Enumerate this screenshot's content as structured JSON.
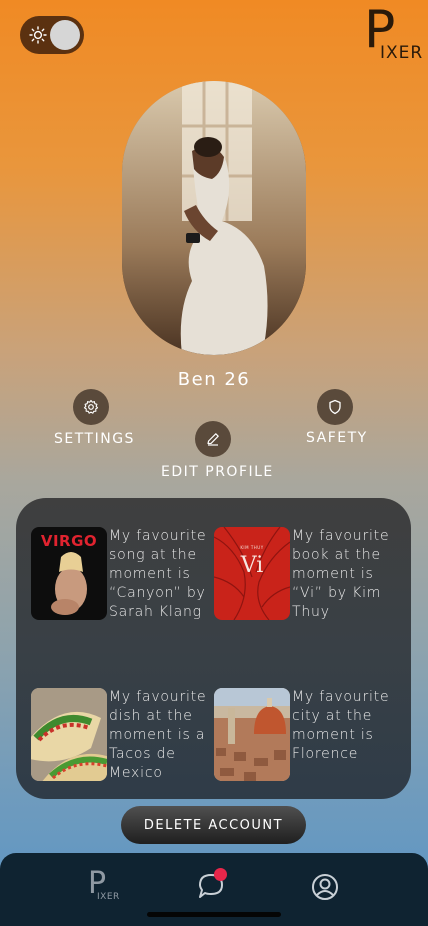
{
  "header": {
    "theme_toggle": {
      "state": "light",
      "icon": "sun-icon"
    },
    "logo": {
      "p": "P",
      "rest": "IXER"
    }
  },
  "profile": {
    "name_age": "Ben 26",
    "photo": "profile-photo"
  },
  "actions": {
    "settings": {
      "label": "SETTINGS",
      "icon": "gear-icon"
    },
    "edit_profile": {
      "label": "EDIT PROFILE",
      "icon": "pencil-icon"
    },
    "safety": {
      "label": "SAFETY",
      "icon": "shield-icon"
    }
  },
  "favourites": [
    {
      "text": "My favourite song at the moment is “Canyon” by Sarah Klang",
      "thumb_text": "VIRGO",
      "thumb": "album-cover"
    },
    {
      "text": "My favourite book at the moment is “Vi” by Kim Thuy",
      "thumb_text": "Vi",
      "thumb_subtext": "KIM THUY",
      "thumb": "book-cover"
    },
    {
      "text": "My favourite dish at the moment is a Tacos de Mexico",
      "thumb": "tacos-photo"
    },
    {
      "text": "My favourite city at the moment is Florence",
      "thumb": "florence-photo"
    }
  ],
  "delete_button": {
    "label": "DELETE ACCOUNT"
  },
  "nav": {
    "home": {
      "p": "P",
      "rest": "IXER",
      "icon": "pixer-logo-icon"
    },
    "chat": {
      "icon": "chat-bubble-icon",
      "has_notification": true
    },
    "profile": {
      "icon": "user-circle-icon"
    }
  },
  "colors": {
    "accent": "#f08a24",
    "notification": "#e8264a",
    "navbar": "#0f2331"
  }
}
